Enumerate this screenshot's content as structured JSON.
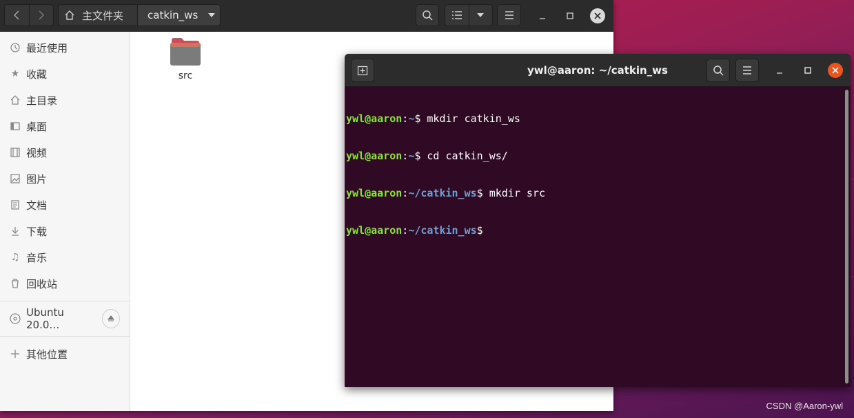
{
  "files": {
    "path_home": "主文件夹",
    "path_current": "catkin_ws",
    "sidebar_items": [
      {
        "label": "最近使用",
        "icon": "clock-icon"
      },
      {
        "label": "收藏",
        "icon": "star-icon"
      },
      {
        "label": "主目录",
        "icon": "home-icon"
      },
      {
        "label": "桌面",
        "icon": "desktop-icon"
      },
      {
        "label": "视频",
        "icon": "video-icon"
      },
      {
        "label": "图片",
        "icon": "picture-icon"
      },
      {
        "label": "文档",
        "icon": "document-icon"
      },
      {
        "label": "下载",
        "icon": "download-icon"
      },
      {
        "label": "音乐",
        "icon": "music-icon"
      },
      {
        "label": "回收站",
        "icon": "trash-icon"
      }
    ],
    "drive_label": "Ubuntu 20.0…",
    "other_locations": "其他位置",
    "folder_name": "src",
    "folder_color": "#e26d5c"
  },
  "terminal": {
    "title": "ywl@aaron: ~/catkin_ws",
    "lines": [
      {
        "user": "ywl@aaron",
        "path": "~",
        "cmd": " mkdir catkin_ws"
      },
      {
        "user": "ywl@aaron",
        "path": "~",
        "cmd": " cd catkin_ws/"
      },
      {
        "user": "ywl@aaron",
        "path": "~/catkin_ws",
        "cmd": " mkdir src"
      },
      {
        "user": "ywl@aaron",
        "path": "~/catkin_ws",
        "cmd": ""
      }
    ],
    "bg_color": "#300a24",
    "user_color": "#8ae234",
    "path_color": "#729fcf"
  },
  "watermark": "CSDN @Aaron-ywl"
}
